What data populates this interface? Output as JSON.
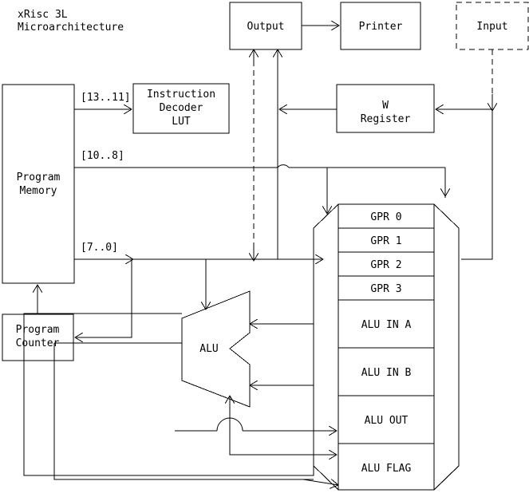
{
  "title": {
    "line1": "xRisc 3L",
    "line2": "Microarchitecture"
  },
  "blocks": {
    "program_memory": "Program\nMemory",
    "program_memory_l1": "Program",
    "program_memory_l2": "Memory",
    "program_counter_l1": "Program",
    "program_counter_l2": "Counter",
    "instruction_decoder_l1": "Instruction",
    "instruction_decoder_l2": "Decoder",
    "instruction_decoder_l3": "LUT",
    "output": "Output",
    "printer": "Printer",
    "input": "Input",
    "w_register_l1": "W",
    "w_register_l2": "Register",
    "alu": "ALU"
  },
  "bus_labels": {
    "instr_high": "[13..11]",
    "instr_mid": "[10..8]",
    "instr_low": "[7..0]"
  },
  "register_file": {
    "rows": [
      {
        "label": "GPR 0"
      },
      {
        "label": "GPR 1"
      },
      {
        "label": "GPR 2"
      },
      {
        "label": "GPR 3"
      },
      {
        "label": "ALU IN A"
      },
      {
        "label": "ALU IN B"
      },
      {
        "label": "ALU OUT"
      },
      {
        "label": "ALU FLAG"
      }
    ]
  },
  "colors": {
    "stroke": "#000000",
    "background": "#ffffff"
  }
}
